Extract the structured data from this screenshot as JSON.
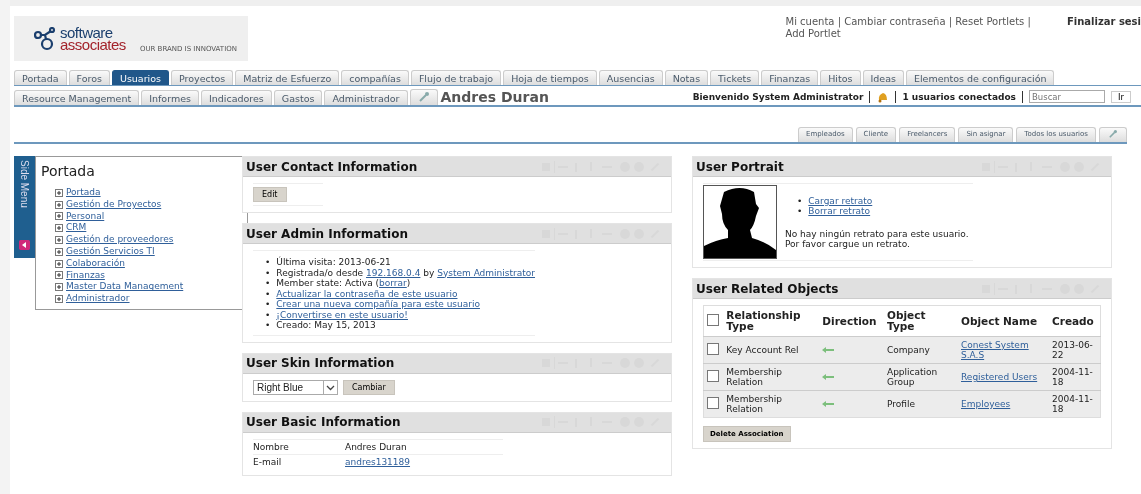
{
  "logo": {
    "word_top": "software",
    "word_bottom": "associates",
    "tagline": "OUR BRAND IS INNOVATION"
  },
  "header_links": {
    "separator": "|",
    "items": [
      "Mi cuenta",
      "Cambiar contraseña",
      "Reset Portlets",
      "Add Portlet"
    ]
  },
  "logout": "Finalizar sesi",
  "main_tabs": [
    {
      "label": "Portada",
      "selected": false
    },
    {
      "label": "Foros",
      "selected": false
    },
    {
      "label": "Usuarios",
      "selected": true
    },
    {
      "label": "Proyectos",
      "selected": false
    },
    {
      "label": "Matriz de Esfuerzo",
      "selected": false
    },
    {
      "label": "compañías",
      "selected": false
    },
    {
      "label": "Flujo de trabajo",
      "selected": false
    },
    {
      "label": "Hoja de tiempos",
      "selected": false
    },
    {
      "label": "Ausencias",
      "selected": false
    },
    {
      "label": "Notas",
      "selected": false
    },
    {
      "label": "Tickets",
      "selected": false
    },
    {
      "label": "Finanzas",
      "selected": false
    },
    {
      "label": "Hitos",
      "selected": false
    },
    {
      "label": "Ideas",
      "selected": false
    },
    {
      "label": "Elementos de configuración",
      "selected": false
    }
  ],
  "second_tabs": [
    {
      "label": "Resource Management",
      "selected": false
    },
    {
      "label": "Informes",
      "selected": false
    },
    {
      "label": "Indicadores",
      "selected": false
    },
    {
      "label": "Gastos",
      "selected": false
    },
    {
      "label": "Administrador",
      "selected": false
    }
  ],
  "page_title": "Andres Duran",
  "welcome": "Bienvenido System Administrator",
  "users_online": "1 usuarios conectados",
  "search": {
    "placeholder": "Buscar",
    "button": "Ir"
  },
  "user_tabs": [
    "Empleados",
    "Cliente",
    "Freelancers",
    "Sin asignar",
    "Todos los usuarios"
  ],
  "side_menu": {
    "tab_label": "Side Menu",
    "title": "Portada",
    "items": [
      "Portada",
      "Gestión de Proyectos",
      "Personal",
      "CRM",
      "Gestión de proveedores",
      "Gestión Servicios TI",
      "Colaboración",
      "Finanzas",
      "Master Data Management",
      "Administrador"
    ]
  },
  "left_portlets": [
    {
      "kind": "contact",
      "title": "User Contact Information",
      "button": "Edit"
    },
    {
      "kind": "admin",
      "title": "User Admin Information",
      "bullet": "•",
      "items": [
        [
          {
            "kind": "text",
            "text": "Última visita: 2013-06-21"
          }
        ],
        [
          {
            "kind": "text",
            "text": "Registrada/o desde "
          },
          {
            "kind": "link",
            "text": "192.168.0.4"
          },
          {
            "kind": "text",
            "text": " by "
          },
          {
            "kind": "link",
            "text": "System Administrator"
          }
        ],
        [
          {
            "kind": "text",
            "text": "Member state: Activa ("
          },
          {
            "kind": "link",
            "text": "borrar"
          },
          {
            "kind": "text",
            "text": ")"
          }
        ],
        [
          {
            "kind": "link",
            "text": "Actualizar la contraseña de este usuario"
          }
        ],
        [
          {
            "kind": "link",
            "text": "Crear una nueva compañía para este usuario"
          }
        ],
        [
          {
            "kind": "link",
            "text": "¡Convertirse en este usuario!"
          }
        ],
        [
          {
            "kind": "text",
            "text": "Creado: May 15, 2013"
          }
        ]
      ]
    },
    {
      "kind": "skin",
      "title": "User Skin Information",
      "value": "Right Blue",
      "button": "Cambiar"
    },
    {
      "kind": "basic",
      "title": "User Basic Information",
      "rows": [
        {
          "label": "Nombre",
          "value": "Andres Duran",
          "kind": "text"
        },
        {
          "label": "E-mail",
          "value": "andres131189",
          "kind": "link"
        }
      ]
    }
  ],
  "right_portlets": [
    {
      "kind": "portrait",
      "title": "User Portrait",
      "bullet": "•",
      "links": [
        "Cargar retrato",
        "Borrar retrato"
      ],
      "message": [
        "No hay ningún retrato para este usuario.",
        "Por favor cargue un retrato."
      ]
    },
    {
      "kind": "related",
      "title": "User Related Objects",
      "all_checked": false,
      "columns": [
        "Relationship Type",
        "Direction",
        "Object Type",
        "Object Name",
        "Creado"
      ],
      "rows": [
        {
          "checked": false,
          "type": "Key Account Rel",
          "object_type": "Company",
          "object_name": "Conest System S.A.S",
          "created": "2013-06-22"
        },
        {
          "checked": false,
          "type": "Membership Relation",
          "object_type": "Application Group",
          "object_name": "Registered Users",
          "created": "2004-11-18"
        },
        {
          "checked": false,
          "type": "Membership Relation",
          "object_type": "Profile",
          "object_name": "Employees",
          "created": "2004-11-18"
        }
      ],
      "button": "Delete Association"
    }
  ]
}
